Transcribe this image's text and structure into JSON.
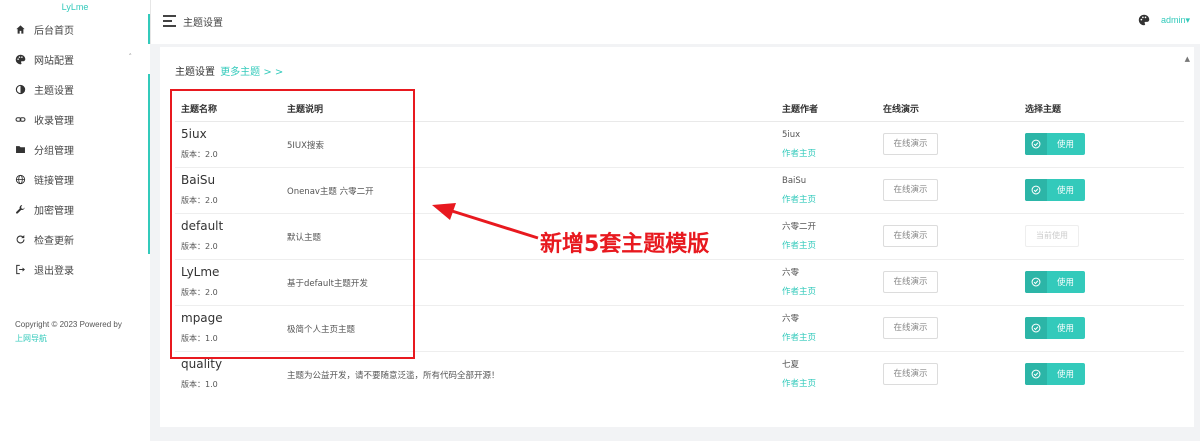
{
  "brand": "LyLme",
  "sidebar": {
    "items": [
      {
        "label": "后台首页",
        "icon": "home-icon"
      },
      {
        "label": "网站配置",
        "icon": "palette-icon",
        "caret": "˄"
      },
      {
        "label": "主题设置",
        "icon": "contrast-icon"
      },
      {
        "label": "收录管理",
        "icon": "link-icon"
      },
      {
        "label": "分组管理",
        "icon": "folder-icon"
      },
      {
        "label": "链接管理",
        "icon": "globe-icon"
      },
      {
        "label": "加密管理",
        "icon": "wrench-icon"
      },
      {
        "label": "检查更新",
        "icon": "refresh-icon"
      },
      {
        "label": "退出登录",
        "icon": "logout-icon"
      }
    ],
    "copyright": "Copyright © 2023 Powered by",
    "copyright_link": "上网导航"
  },
  "topbar": {
    "title": "主题设置",
    "user": "admin▾"
  },
  "card": {
    "title": "主题设置",
    "more_link": "更多主题 > >",
    "scroll_up": "▲"
  },
  "table": {
    "headers": [
      "主题名称",
      "主题说明",
      "主题作者",
      "在线演示",
      "选择主题"
    ],
    "rows": [
      {
        "name": "5iux",
        "version": "版本：2.0",
        "desc": "5IUX搜索",
        "author": "5iux",
        "author_link": "作者主页",
        "demo": "在线演示",
        "action": "使用",
        "current": false
      },
      {
        "name": "BaiSu",
        "version": "版本：2.0",
        "desc": "Onenav主题 六零二开",
        "author": "BaiSu",
        "author_link": "作者主页",
        "demo": "在线演示",
        "action": "使用",
        "current": false
      },
      {
        "name": "default",
        "version": "版本：2.0",
        "desc": "默认主题",
        "author": "六零二开",
        "author_link": "作者主页",
        "demo": "在线演示",
        "action": "当前使用",
        "current": true
      },
      {
        "name": "LyLme",
        "version": "版本：2.0",
        "desc": "基于default主题开发",
        "author": "六零",
        "author_link": "作者主页",
        "demo": "在线演示",
        "action": "使用",
        "current": false
      },
      {
        "name": "mpage",
        "version": "版本：1.0",
        "desc": "极简个人主页主题",
        "author": "六零",
        "author_link": "作者主页",
        "demo": "在线演示",
        "action": "使用",
        "current": false
      },
      {
        "name": "quality",
        "version": "版本：1.0",
        "desc": "主题为公益开发，请不要随意泛滥，所有代码全部开源！",
        "author": "七夏",
        "author_link": "作者主页",
        "demo": "在线演示",
        "action": "使用",
        "current": false
      }
    ]
  },
  "annotation": {
    "text": "新增5套主题模版",
    "color": "#e8191f"
  },
  "colors": {
    "accent": "#33cabb",
    "annotation": "#e8191f"
  }
}
